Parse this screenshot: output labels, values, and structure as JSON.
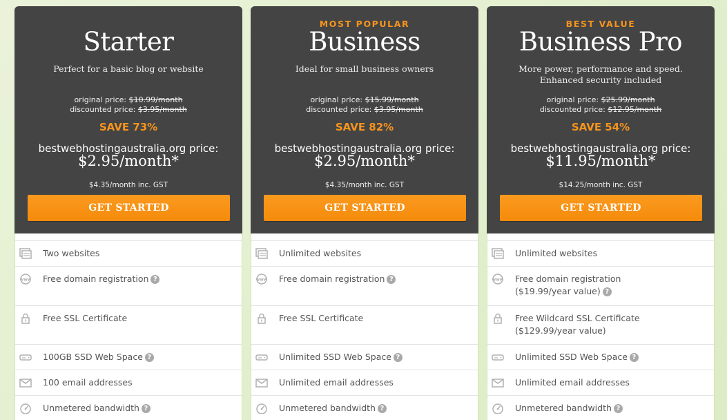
{
  "plans": [
    {
      "badge": "",
      "name": "Starter",
      "tagline": "Perfect for a basic blog or website",
      "original_label": "original price:",
      "original_price": "$10.99/month",
      "discounted_label": "discounted price:",
      "discounted_price": "$3.95/month",
      "save": "SAVE 73%",
      "site_label": "bestwebhostingaustralia.org price:",
      "site_price": "$2.95/month*",
      "gst": "$4.35/month inc. GST",
      "cta": "GET STARTED",
      "features": {
        "websites": "Two websites",
        "domain_line1": "Free domain registration",
        "domain_line2": "",
        "ssl_line1": "Free SSL Certificate",
        "ssl_line2": "",
        "space": "100GB SSD Web Space",
        "email": "100 email addresses",
        "bandwidth": "Unmetered bandwidth"
      }
    },
    {
      "badge": "MOST POPULAR",
      "name": "Business",
      "tagline": "Ideal for small business owners",
      "original_label": "original price:",
      "original_price": "$15.99/month",
      "discounted_label": "discounted price:",
      "discounted_price": "$3.95/month",
      "save": "SAVE 82%",
      "site_label": "bestwebhostingaustralia.org price:",
      "site_price": "$2.95/month*",
      "gst": "$4.35/month inc. GST",
      "cta": "GET STARTED",
      "features": {
        "websites": "Unlimited websites",
        "domain_line1": "Free domain registration",
        "domain_line2": "",
        "ssl_line1": "Free SSL Certificate",
        "ssl_line2": "",
        "space": "Unlimited SSD Web Space",
        "email": "Unlimited email addresses",
        "bandwidth": "Unmetered bandwidth"
      }
    },
    {
      "badge": "BEST VALUE",
      "name": "Business Pro",
      "tagline": "More power, performance and speed. Enhanced security included",
      "original_label": "original price:",
      "original_price": "$25.99/month",
      "discounted_label": "discounted price:",
      "discounted_price": "$12.95/month",
      "save": "SAVE 54%",
      "site_label": "bestwebhostingaustralia.org price:",
      "site_price": "$11.95/month*",
      "gst": "$14.25/month inc. GST",
      "cta": "GET STARTED",
      "features": {
        "websites": "Unlimited websites",
        "domain_line1": "Free domain registration",
        "domain_line2": "($19.99/year value)",
        "ssl_line1": "Free Wildcard SSL Certificate",
        "ssl_line2": "($129.99/year value)",
        "space": "Unlimited SSD Web Space",
        "email": "Unlimited email addresses",
        "bandwidth": "Unmetered bandwidth"
      }
    }
  ],
  "help_glyph": "?",
  "colors": {
    "accent": "#f7941d",
    "card_header": "#444444",
    "background": "#e4efd0"
  },
  "icons": [
    "websites-icon",
    "www-icon",
    "lock-icon",
    "hard-drive-icon",
    "envelope-icon",
    "gauge-icon"
  ]
}
